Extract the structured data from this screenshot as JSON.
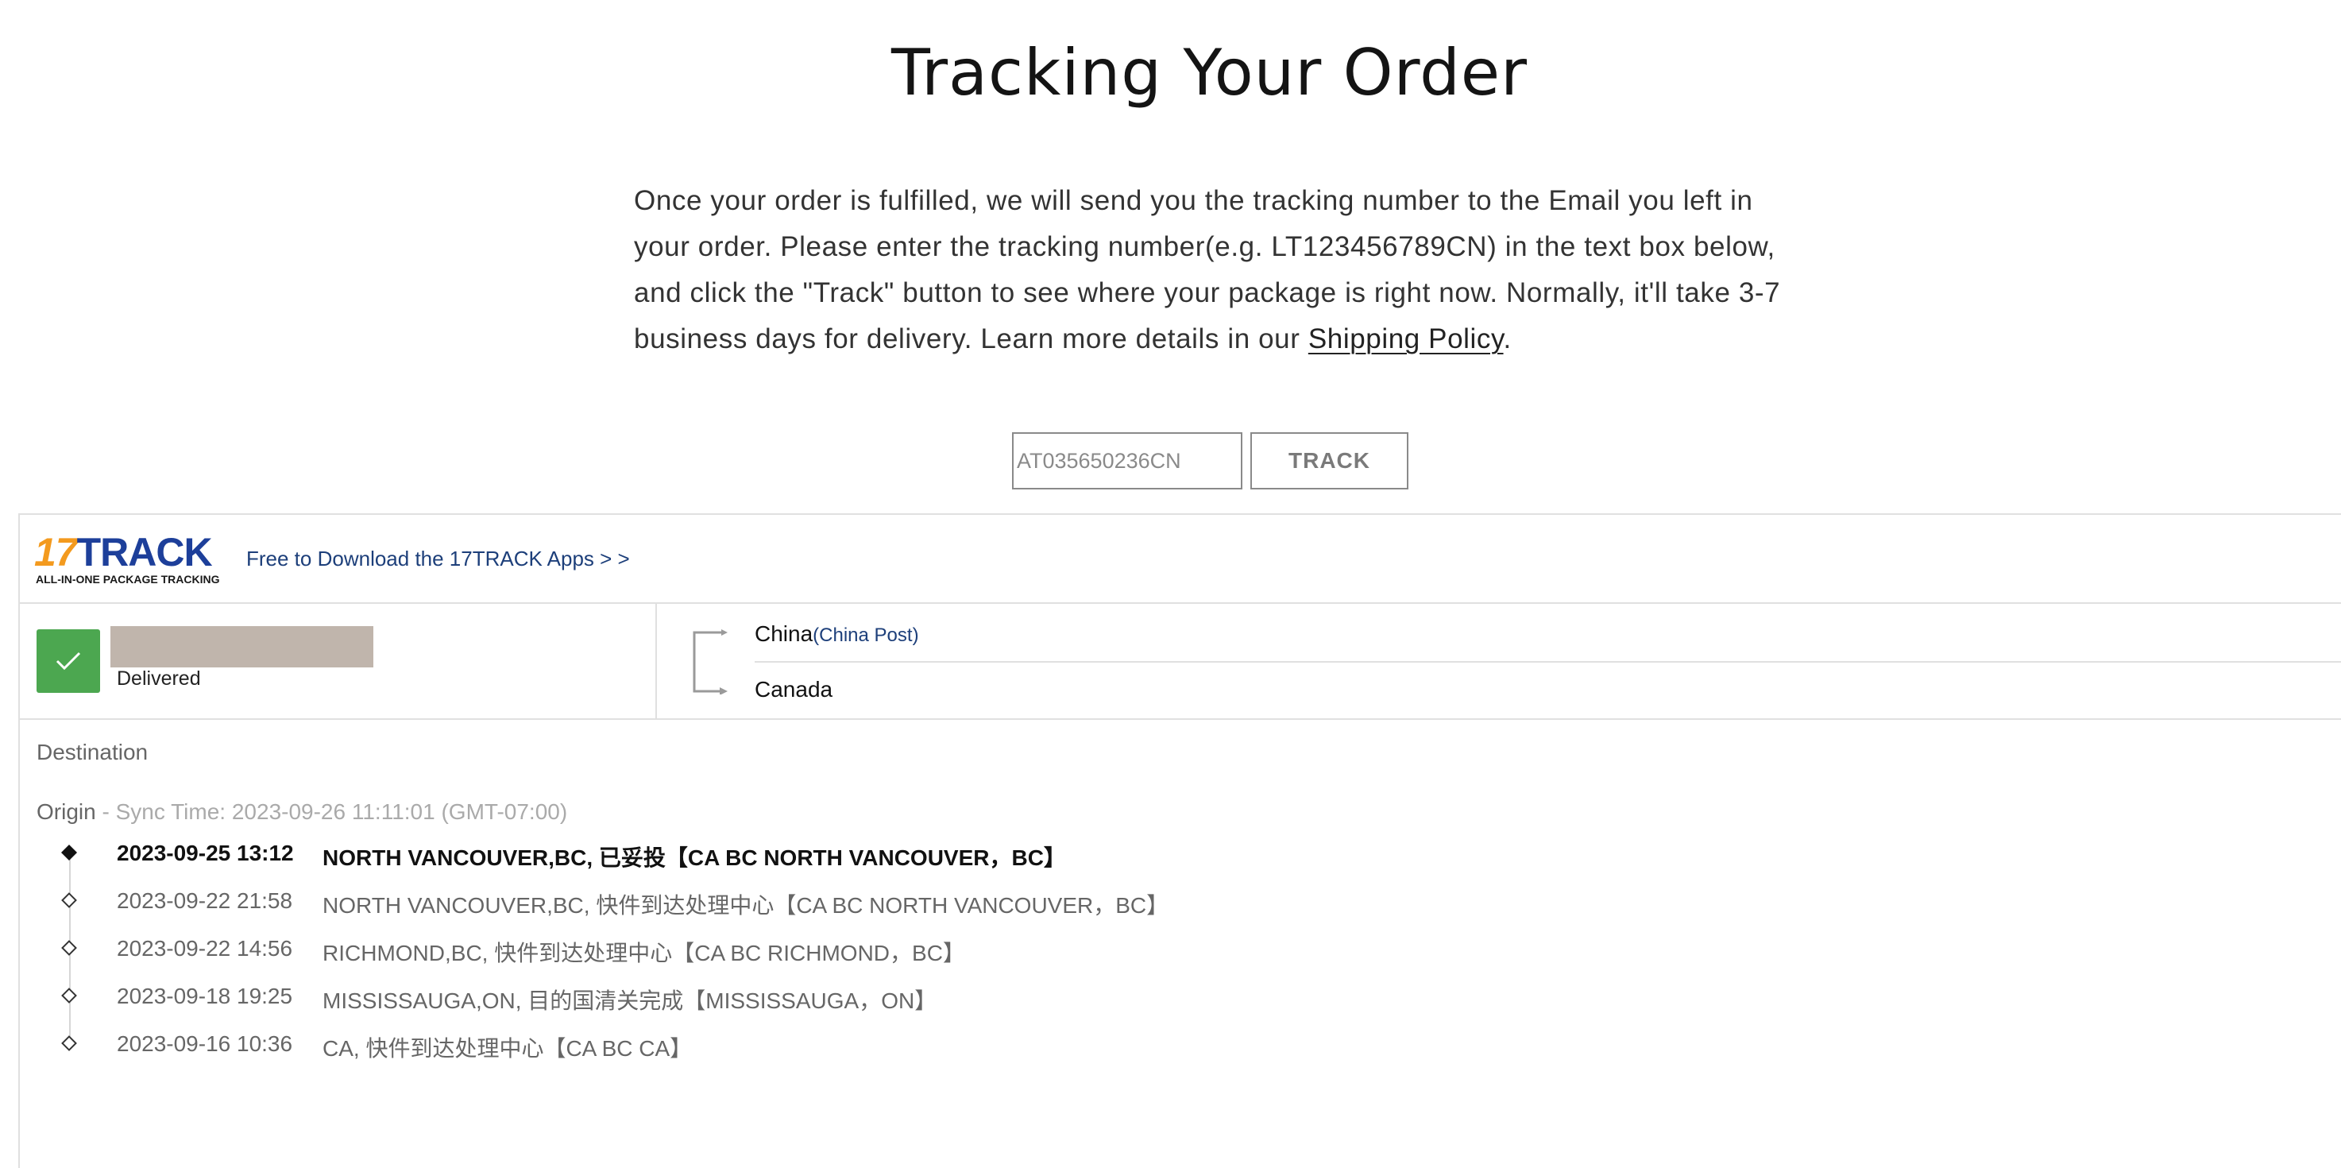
{
  "page": {
    "title": "Tracking Your Order",
    "intro_before_link": "Once your order is fulfilled, we will send you the tracking number to the Email you left in your order. Please enter the tracking number(e.g. LT123456789CN) in the text box below, and click the \"Track\" button to see where your package is right now. Normally, it'll take 3-7 business days for delivery. Learn more details in our ",
    "intro_link": "Shipping Policy",
    "intro_after_link": "."
  },
  "tracking_form": {
    "input_value": "AT035650236CN",
    "button_label": "TRACK"
  },
  "widget": {
    "logo_number": "17",
    "logo_word": "TRACK",
    "logo_tagline": "ALL-IN-ONE PACKAGE TRACKING",
    "apps_link": "Free to Download the 17TRACK Apps > >",
    "status": "Delivered",
    "status_color": "#4ca750",
    "origin_country": "China",
    "origin_carrier": "(China Post)",
    "destination_country": "Canada",
    "destination_label": "Destination",
    "origin_label": "Origin",
    "sync_time": " - Sync Time: 2023-09-26 11:11:01 (GMT-07:00)",
    "events": [
      {
        "time": "2023-09-25 13:12",
        "description": "NORTH VANCOUVER,BC, 已妥投【CA BC NORTH VANCOUVER，BC】"
      },
      {
        "time": "2023-09-22 21:58",
        "description": "NORTH VANCOUVER,BC, 快件到达处理中心【CA BC NORTH VANCOUVER，BC】"
      },
      {
        "time": "2023-09-22 14:56",
        "description": "RICHMOND,BC, 快件到达处理中心【CA BC RICHMOND，BC】"
      },
      {
        "time": "2023-09-18 19:25",
        "description": "MISSISSAUGA,ON, 目的国清关完成【MISSISSAUGA，ON】"
      },
      {
        "time": "2023-09-16 10:36",
        "description": "CA, 快件到达处理中心【CA BC CA】"
      }
    ]
  }
}
